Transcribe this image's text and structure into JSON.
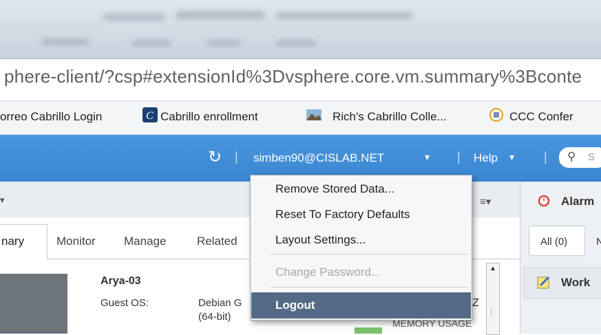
{
  "browser": {
    "url": "phere-client/?csp#extensionId%3Dvsphere.core.vm.summary%3Bconte",
    "bookmarks": [
      {
        "label": "orreo Cabrillo Login"
      },
      {
        "label": "Cabrillo enrollment"
      },
      {
        "label": "Rich's Cabrillo Colle..."
      },
      {
        "label": "CCC Confer"
      }
    ]
  },
  "header": {
    "user": "simben90@CISLAB.NET",
    "user_caret": "▾",
    "help": "Help",
    "help_caret": "▾",
    "refresh_icon": "↻",
    "separator": "|",
    "search_icon": "⚲",
    "search_placeholder": "S"
  },
  "toolbar": {
    "collapse_caret": "▾",
    "list_icon": "≡▾"
  },
  "tabs": [
    {
      "label": "nary"
    },
    {
      "label": "Monitor"
    },
    {
      "label": "Manage"
    },
    {
      "label": "Related"
    }
  ],
  "vm": {
    "name": "Arya-03",
    "guest_os_label": "Guest OS:",
    "guest_os_value": "Debian G",
    "guest_os_bits": "(64-bit)",
    "cpu_unit_fragment": "Z",
    "memory_usage_label": "MEMORY USAGE"
  },
  "right_panel": {
    "alarms": "Alarm",
    "all_tab": "All (0)",
    "next_tab": "N",
    "work": "Work"
  },
  "user_menu": [
    {
      "label": "Remove Stored Data...",
      "enabled": true
    },
    {
      "label": "Reset To Factory Defaults",
      "enabled": true
    },
    {
      "label": "Layout Settings...",
      "enabled": true
    },
    {
      "label": "Change Password...",
      "enabled": false
    },
    {
      "label": "Logout",
      "enabled": true,
      "highlighted": true
    }
  ],
  "colors": {
    "header_blue": "#3d8ad6",
    "menu_highlight": "#546a86"
  }
}
